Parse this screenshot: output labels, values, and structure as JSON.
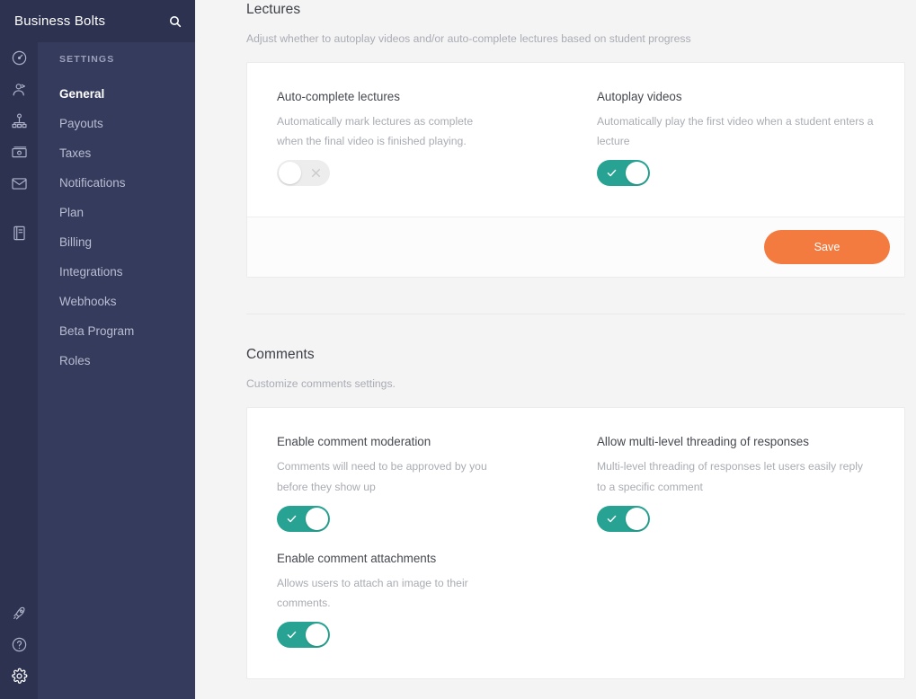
{
  "brand": {
    "title": "Business Bolts",
    "search_icon": "search-icon"
  },
  "rail": {
    "top_icons": [
      {
        "name": "dashboard-gauge-icon",
        "label": "Dashboard"
      },
      {
        "name": "students-icon",
        "label": "Students"
      },
      {
        "name": "org-chart-icon",
        "label": "Structure"
      },
      {
        "name": "payments-icon",
        "label": "Payments"
      },
      {
        "name": "mail-icon",
        "label": "Mail"
      },
      {
        "name": "book-icon",
        "label": "Courses"
      }
    ],
    "bottom_icons": [
      {
        "name": "rocket-icon",
        "label": "Launch"
      },
      {
        "name": "help-circle-icon",
        "label": "Help"
      },
      {
        "name": "gear-icon",
        "label": "Settings",
        "active": true
      }
    ]
  },
  "sidebar": {
    "heading": "SETTINGS",
    "items": [
      {
        "label": "General",
        "active": true
      },
      {
        "label": "Payouts",
        "active": false
      },
      {
        "label": "Taxes",
        "active": false
      },
      {
        "label": "Notifications",
        "active": false
      },
      {
        "label": "Plan",
        "active": false
      },
      {
        "label": "Billing",
        "active": false
      },
      {
        "label": "Integrations",
        "active": false
      },
      {
        "label": "Webhooks",
        "active": false
      },
      {
        "label": "Beta Program",
        "active": false
      },
      {
        "label": "Roles",
        "active": false
      }
    ]
  },
  "lectures": {
    "title": "Lectures",
    "subtitle": "Adjust whether to autoplay videos and/or auto-complete lectures based on student progress",
    "fields": [
      {
        "title": "Auto-complete lectures",
        "desc": "Automatically mark lectures as complete when the final video is finished playing.",
        "toggle": "off"
      },
      {
        "title": "Autoplay videos",
        "desc": "Automatically play the first video when a student enters a lecture",
        "toggle": "on"
      }
    ],
    "save_label": "Save"
  },
  "comments": {
    "title": "Comments",
    "subtitle": "Customize comments settings.",
    "fields": [
      {
        "title": "Enable comment moderation",
        "desc": "Comments will need to be approved by you before they show up",
        "toggle": "on"
      },
      {
        "title": "Allow multi-level threading of responses",
        "desc": "Multi-level threading of responses let users easily reply to a specific comment",
        "toggle": "on"
      },
      {
        "title": "Enable comment attachments",
        "desc": "Allows users to attach an image to their comments.",
        "toggle": "on"
      }
    ]
  },
  "colors": {
    "rail_bg": "#2d3250",
    "nav_bg": "#353b5c",
    "toggle_on": "#28a393",
    "toggle_off": "#ededee",
    "save_button": "#f47b40",
    "page_bg": "#f4f4f5"
  }
}
